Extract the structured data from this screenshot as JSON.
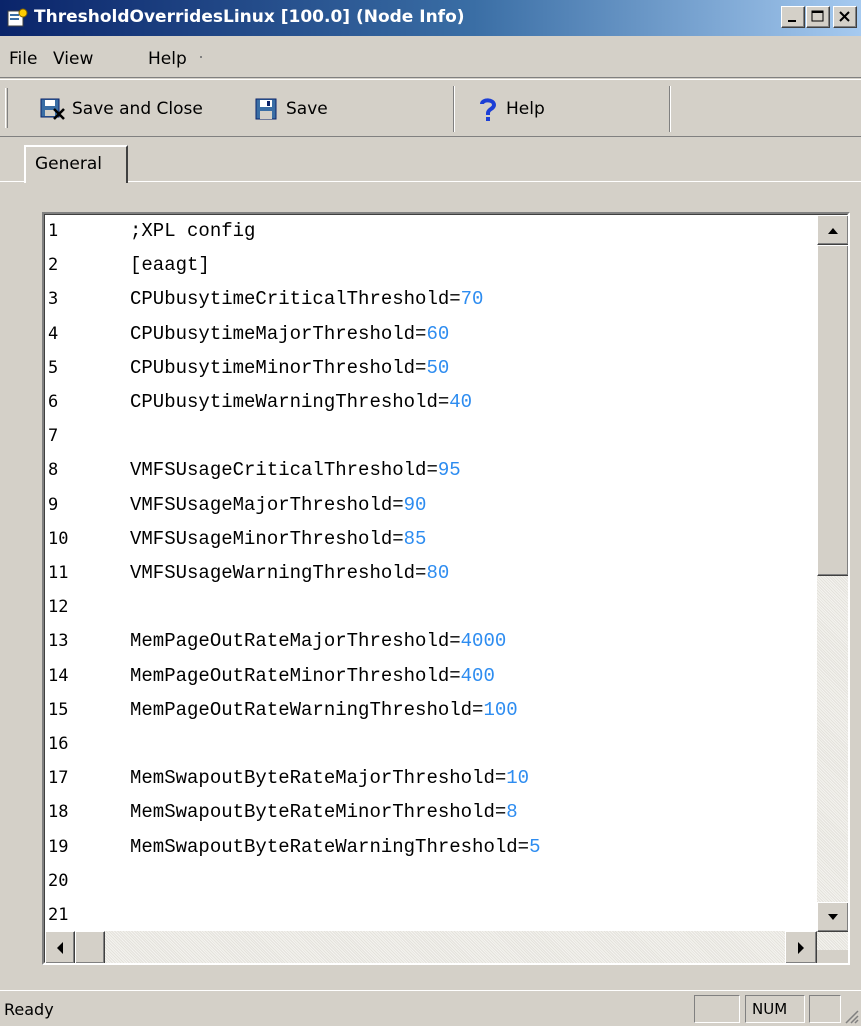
{
  "window": {
    "title": "ThresholdOverridesLinux [100.0]  (Node Info)",
    "icon": "document-settings-icon"
  },
  "menu": {
    "items": [
      {
        "label": "File"
      },
      {
        "label": "View"
      },
      {
        "label": "Help"
      }
    ]
  },
  "toolbar": {
    "save_close_label": "Save and Close",
    "save_label": "Save",
    "help_label": "Help"
  },
  "tabs": [
    {
      "label": "General",
      "selected": true
    }
  ],
  "editor": {
    "lines": [
      {
        "num": "1",
        "text": ";XPL config",
        "value": ""
      },
      {
        "num": "2",
        "text": "[eaagt]",
        "value": ""
      },
      {
        "num": "3",
        "text": "CPUbusytimeCriticalThreshold=",
        "value": "70"
      },
      {
        "num": "4",
        "text": "CPUbusytimeMajorThreshold=",
        "value": "60"
      },
      {
        "num": "5",
        "text": "CPUbusytimeMinorThreshold=",
        "value": "50"
      },
      {
        "num": "6",
        "text": "CPUbusytimeWarningThreshold=",
        "value": "40"
      },
      {
        "num": "7",
        "text": "",
        "value": ""
      },
      {
        "num": "8",
        "text": "VMFSUsageCriticalThreshold=",
        "value": "95"
      },
      {
        "num": "9",
        "text": "VMFSUsageMajorThreshold=",
        "value": "90"
      },
      {
        "num": "10",
        "text": "VMFSUsageMinorThreshold=",
        "value": "85"
      },
      {
        "num": "11",
        "text": "VMFSUsageWarningThreshold=",
        "value": "80"
      },
      {
        "num": "12",
        "text": "",
        "value": ""
      },
      {
        "num": "13",
        "text": "MemPageOutRateMajorThreshold=",
        "value": "4000"
      },
      {
        "num": "14",
        "text": "MemPageOutRateMinorThreshold=",
        "value": "400"
      },
      {
        "num": "15",
        "text": "MemPageOutRateWarningThreshold=",
        "value": "100"
      },
      {
        "num": "16",
        "text": "",
        "value": ""
      },
      {
        "num": "17",
        "text": "MemSwapoutByteRateMajorThreshold=",
        "value": "10"
      },
      {
        "num": "18",
        "text": "MemSwapoutByteRateMinorThreshold=",
        "value": "8"
      },
      {
        "num": "19",
        "text": "MemSwapoutByteRateWarningThreshold=",
        "value": "5"
      },
      {
        "num": "20",
        "text": "",
        "value": ""
      },
      {
        "num": "21",
        "text": "",
        "value": ""
      }
    ],
    "value_color": "#2d8cf0"
  },
  "status": {
    "text": "Ready",
    "num_indicator": "NUM"
  }
}
